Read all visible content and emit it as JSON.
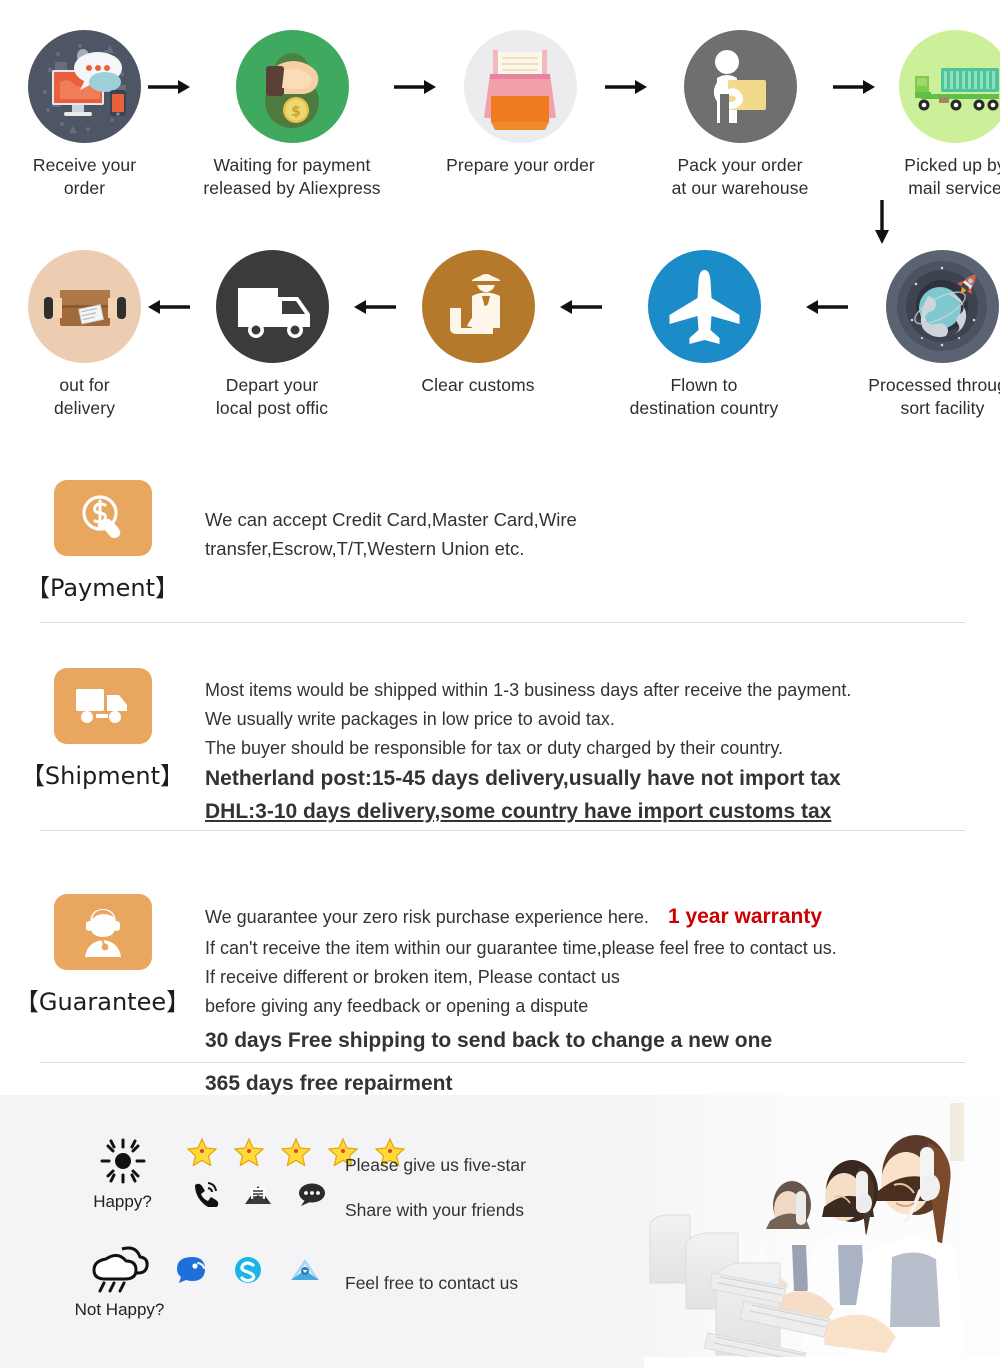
{
  "process": {
    "row1": [
      {
        "label": "Receive your order",
        "icon": "order-received-icon"
      },
      {
        "label": "Waiting for payment\nreleased by Aliexpress",
        "icon": "payment-hand-money-icon"
      },
      {
        "label": "Prepare your order",
        "icon": "printer-icon"
      },
      {
        "label": "Pack your order\nat our warehouse",
        "icon": "worker-packing-icon"
      },
      {
        "label": "Picked up by\nmail service",
        "icon": "green-truck-icon"
      }
    ],
    "row2": [
      {
        "label": "out for delivery",
        "icon": "package-handoff-icon"
      },
      {
        "label": "Depart your\nlocal post offic",
        "icon": "delivery-van-icon"
      },
      {
        "label": "Clear customs",
        "icon": "customs-officer-icon"
      },
      {
        "label": "Flown to\ndestination country",
        "icon": "airplane-icon"
      },
      {
        "label": "Processed through\nsort facility",
        "icon": "globe-rocket-icon"
      }
    ]
  },
  "sections": {
    "payment": {
      "title": "【Payment】",
      "icon": "money-click-icon",
      "lines": [
        "We can accept Credit Card,Master Card,Wire",
        "transfer,Escrow,T/T,Western Union etc."
      ]
    },
    "shipment": {
      "title": "【Shipment】",
      "icon": "truck-icon",
      "lines": [
        "Most items would be shipped within 1-3 business days after receive the payment.",
        "We usually write packages in low price to avoid tax.",
        "The buyer should be responsible for tax or duty charged by their country."
      ],
      "bold_lines": [
        "Netherland post:15-45 days delivery,usually have not import tax",
        "DHL:3-10 days delivery,some country have import customs tax"
      ]
    },
    "guarantee": {
      "title": "【Guarantee】",
      "icon": "support-agent-icon",
      "line1": "We guarantee your zero risk purchase experience here.",
      "line1_highlight": "1 year warranty",
      "lines": [
        "If can't receive the item within our guarantee time,please feel free to contact us.",
        "If receive different or broken item, Please contact us",
        "before giving any feedback or opening a dispute"
      ],
      "red_lines": [
        "30 days Free shipping to send back to change a new one",
        "365 days free repairment"
      ]
    }
  },
  "footer": {
    "happy": {
      "label": "Happy?",
      "icon": "sun-icon",
      "stars": 5,
      "star_icon": "star-icon",
      "contact_icons": [
        "phone-icon",
        "email-icon",
        "chat-bubble-icon"
      ],
      "messages": [
        "Please give us five-star",
        "Share with your friends"
      ]
    },
    "not_happy": {
      "label": "Not Happy?",
      "icon": "rain-cloud-icon",
      "contact_icons": [
        "messenger-icon",
        "skype-icon",
        "mail-open-icon"
      ],
      "messages": [
        "Feel free to contact us"
      ]
    },
    "photo": "customer-service-team-photo"
  },
  "colors": {
    "badge_orange": "#e9a65e",
    "red": "#cc0000",
    "footer_bg": "#f4f3f5",
    "divider": "#dcdcdc"
  }
}
